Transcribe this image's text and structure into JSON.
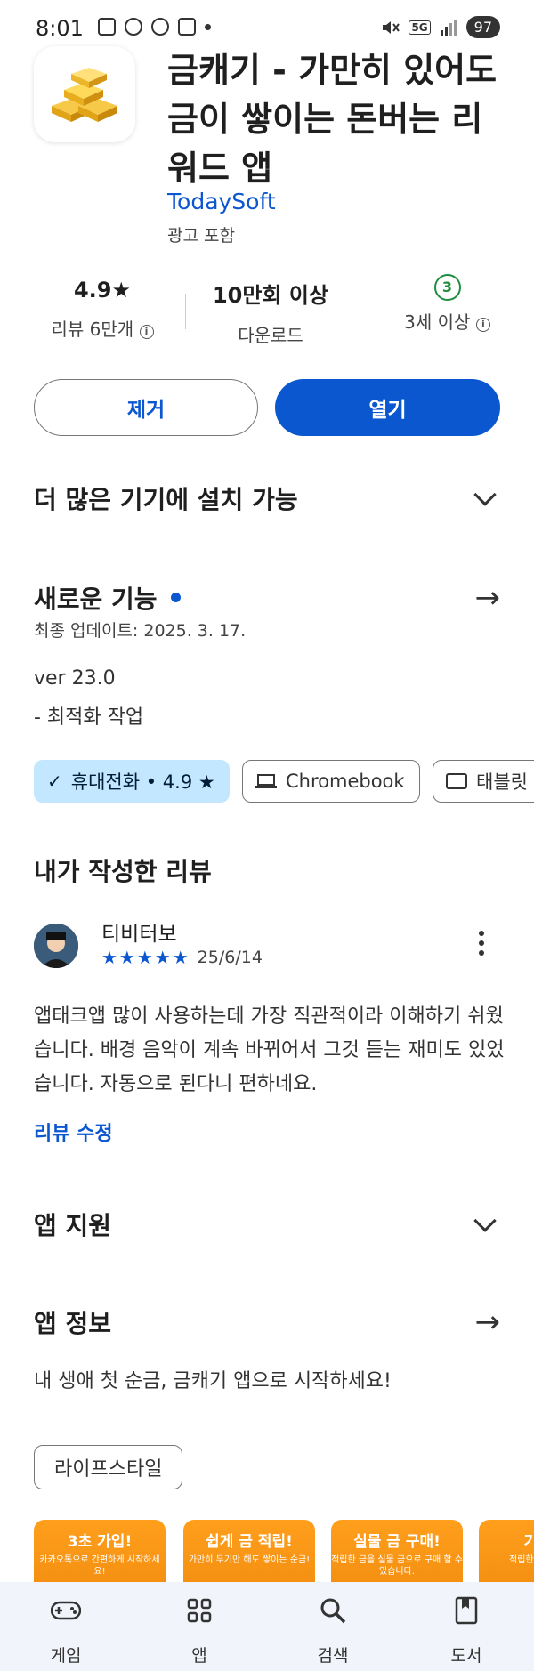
{
  "status_bar": {
    "time": "8:01",
    "battery": "97",
    "network": "5G"
  },
  "app": {
    "title": "금캐기 - 가만히 있어도 금이 쌓이는 돈버는 리워드 앱",
    "developer": "TodaySoft",
    "ads": "광고 포함"
  },
  "stats": {
    "rating": "4.9★",
    "reviews": "리뷰 6만개",
    "downloads": "10만회 이상",
    "downloads_label": "다운로드",
    "age_badge": "3",
    "age_label": "3세 이상"
  },
  "buttons": {
    "remove": "제거",
    "open": "열기"
  },
  "more_devices": "더 많은 기기에 설치 가능",
  "whats_new": {
    "title": "새로운 기능",
    "updated": "최종 업데이트: 2025. 3. 17.",
    "version": "ver 23.0",
    "notes": "- 최적화 작업"
  },
  "devices": [
    {
      "label": "휴대전화 • 4.9 ★",
      "selected": true
    },
    {
      "label": "Chromebook",
      "selected": false
    },
    {
      "label": "태블릿",
      "selected": false
    }
  ],
  "my_review": {
    "section_title": "내가 작성한 리뷰",
    "reviewer": "티비터보",
    "stars": "★★★★★",
    "date": "25/6/14",
    "text": "앱태크앱 많이 사용하는데 가장 직관적이라 이해하기 쉬웠습니다. 배경 음악이 계속 바뀌어서 그것 듣는 재미도 있었습니다. 자동으로 된다니 편하네요.",
    "edit_link": "리뷰 수정"
  },
  "app_support": "앱 지원",
  "about": {
    "title": "앱 정보",
    "description": "내 생애 첫 순금, 금캐기 앱으로 시작하세요!",
    "category": "라이프스타일"
  },
  "screenshots": [
    {
      "heading": "3초 가입!",
      "sub": "카카오톡으로 간편하게 시작하세요!"
    },
    {
      "heading": "쉽게 금 적립!",
      "sub": "가만히 두기만 해도 쌓이는 순금!"
    },
    {
      "heading": "실물 금 구매!",
      "sub": "적립한 금을 실물 금으로 구매 할 수 있습니다."
    },
    {
      "heading": "기프티",
      "sub": "적립한 금 기프티콘"
    }
  ],
  "bottom_nav": [
    {
      "label": "게임",
      "icon": "gamepad-icon"
    },
    {
      "label": "앱",
      "icon": "apps-grid-icon"
    },
    {
      "label": "검색",
      "icon": "search-icon"
    },
    {
      "label": "도서",
      "icon": "book-icon"
    }
  ],
  "colors": {
    "accent": "#0b57d0",
    "chip_selected": "#c2e7ff",
    "age_green": "#1e8e3e",
    "screenshot_orange": "#ff9f1c"
  }
}
